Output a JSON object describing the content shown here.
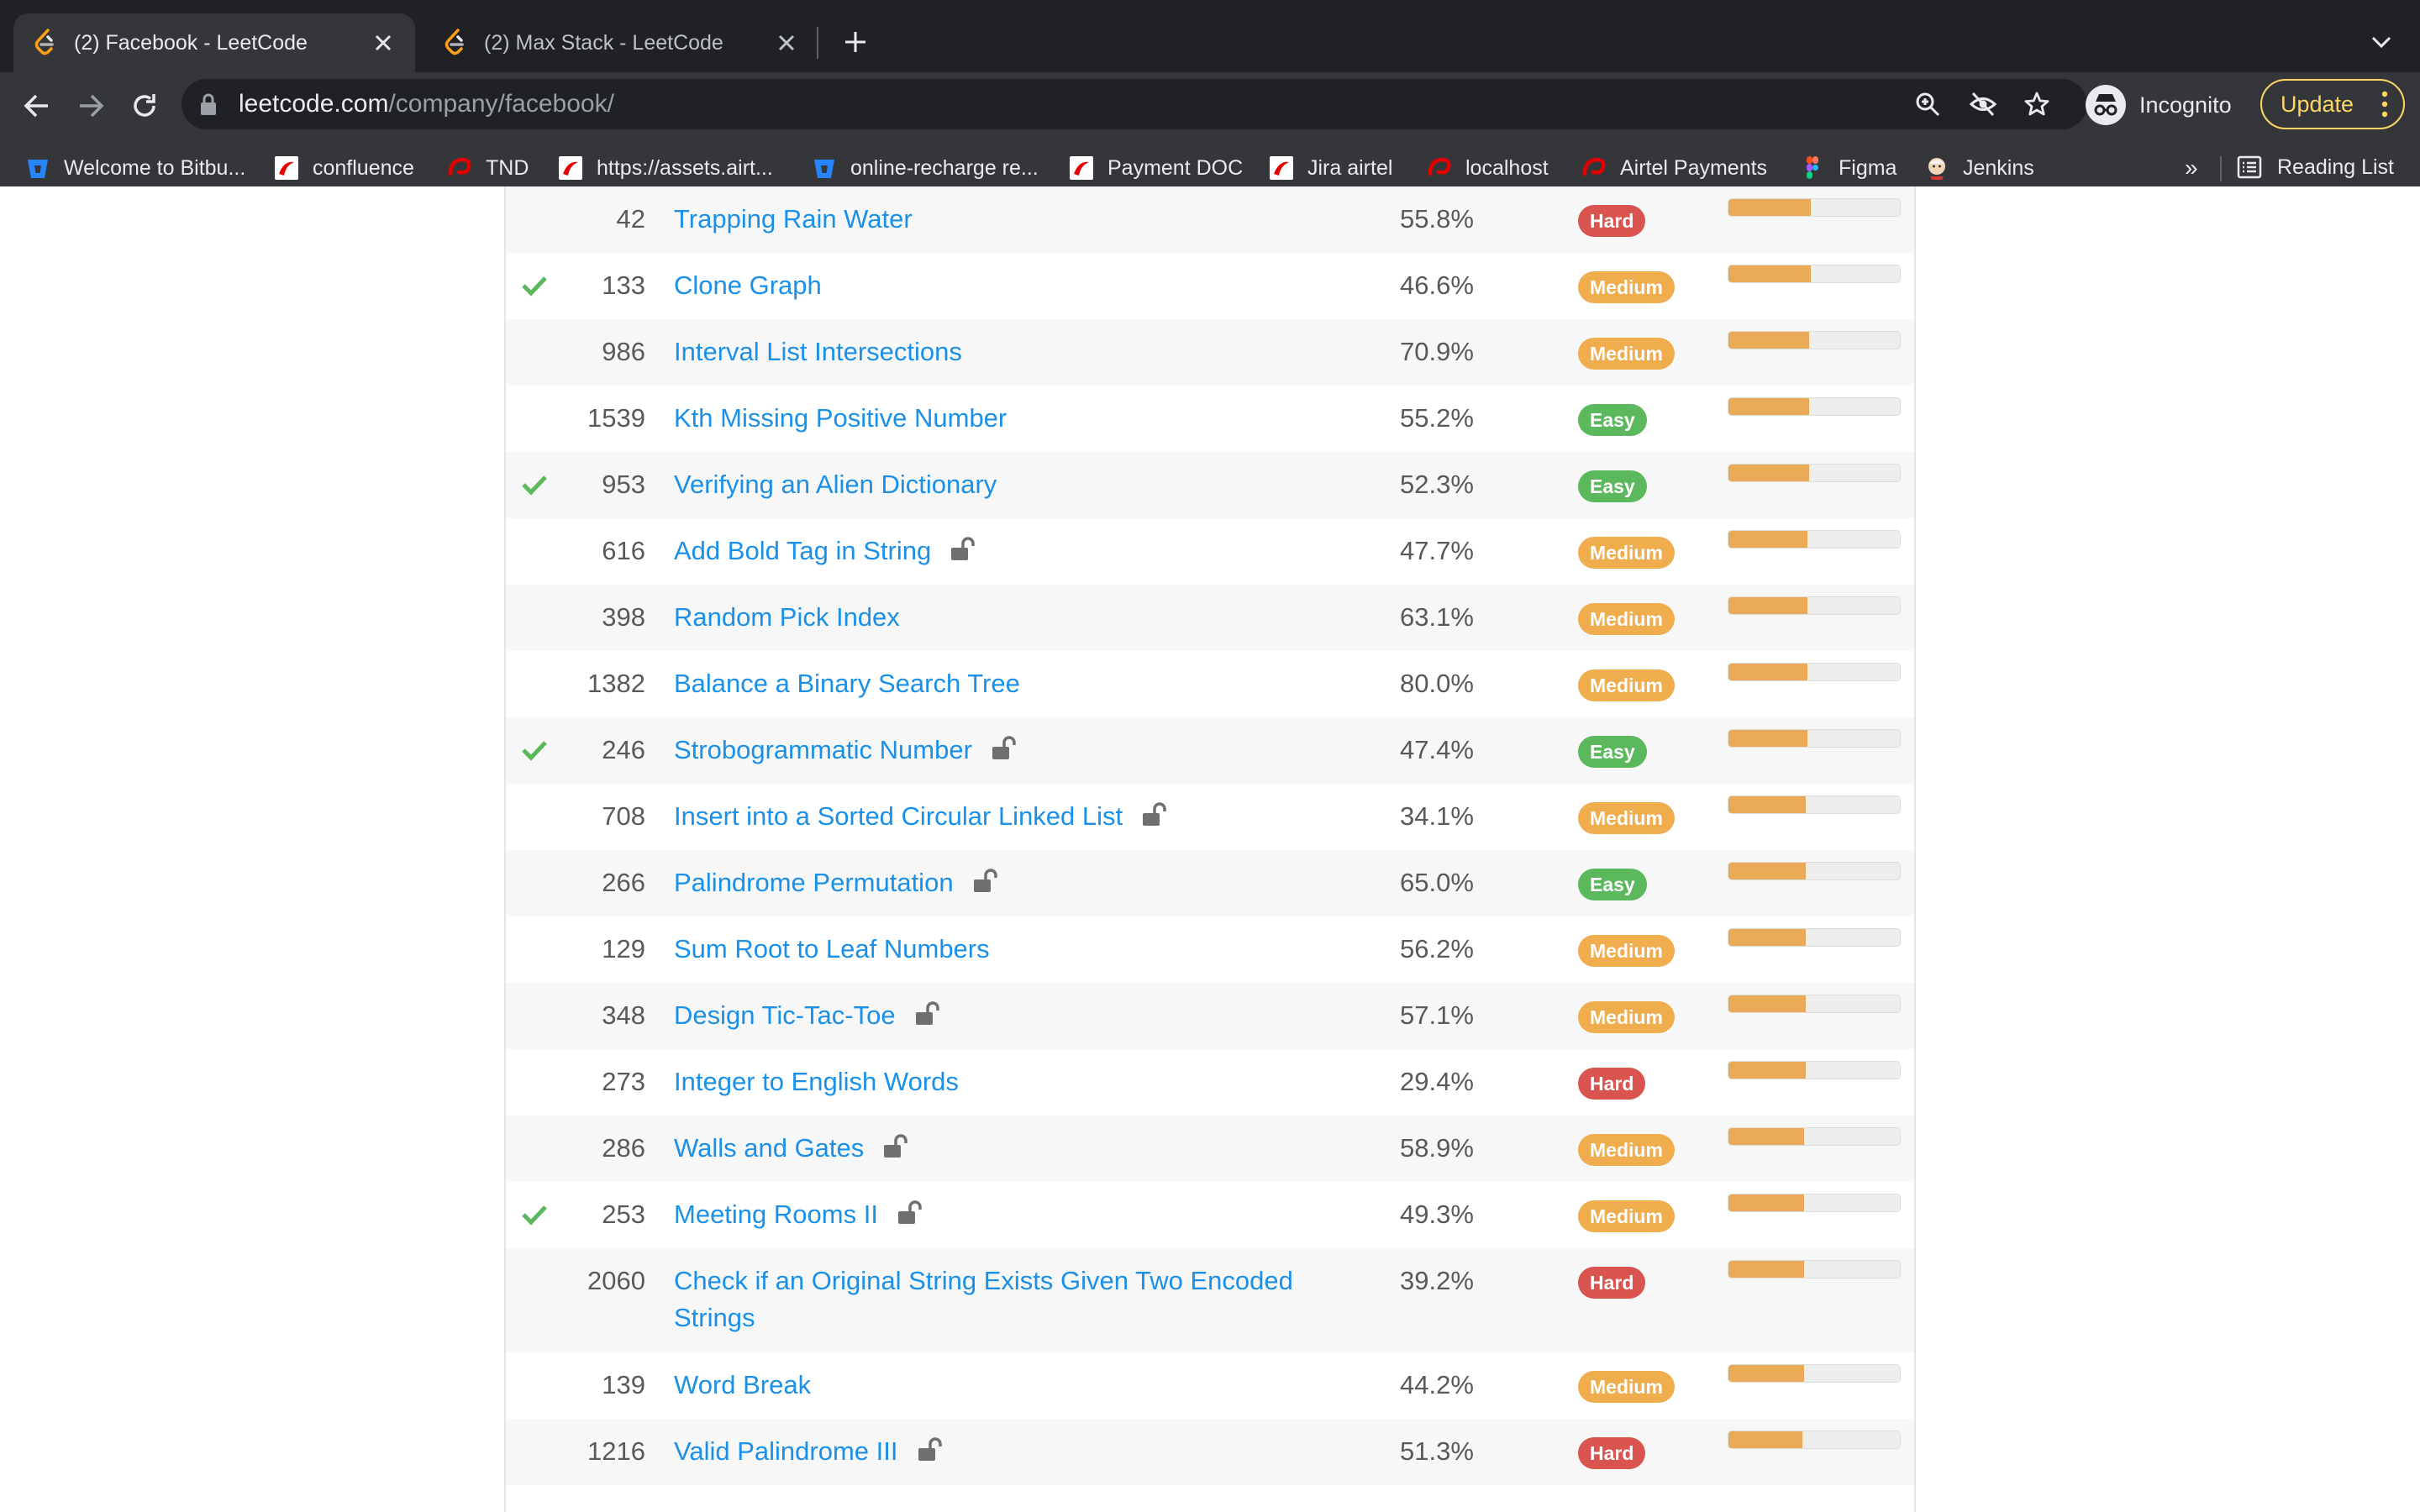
{
  "browser": {
    "tabs": [
      {
        "title": "(2) Facebook - LeetCode",
        "active": true
      },
      {
        "title": "(2) Max Stack - LeetCode",
        "active": false
      }
    ],
    "url": {
      "domain": "leetcode.com",
      "path": "/company/facebook/"
    },
    "incognito_label": "Incognito",
    "update_label": "Update",
    "bookmarks": [
      {
        "label": "Welcome to Bitbu...",
        "icon": "bitbucket-icon"
      },
      {
        "label": "confluence",
        "icon": "airtel-icon"
      },
      {
        "label": "TND",
        "icon": "airtel-swirl-icon"
      },
      {
        "label": "https://assets.airt...",
        "icon": "airtel-icon"
      },
      {
        "label": "online-recharge re...",
        "icon": "bitbucket-icon"
      },
      {
        "label": "Payment DOC",
        "icon": "airtel-icon"
      },
      {
        "label": "Jira airtel",
        "icon": "airtel-icon"
      },
      {
        "label": "localhost",
        "icon": "airtel-swirl-icon"
      },
      {
        "label": "Airtel Payments",
        "icon": "airtel-swirl-icon"
      },
      {
        "label": "Figma",
        "icon": "figma-icon"
      },
      {
        "label": "Jenkins",
        "icon": "jenkins-icon"
      }
    ],
    "bookmarks_overflow": "»",
    "reading_list_label": "Reading List"
  },
  "colors": {
    "easy": "#5cb85c",
    "medium": "#f0ad4e",
    "hard": "#d9534f",
    "link": "#1a90e8",
    "check": "#5cb85c",
    "frequency": "#e9aa55"
  },
  "problems": [
    {
      "id": "42",
      "title": "Trapping Rain Water",
      "acceptance": "55.8%",
      "difficulty": "Hard",
      "solved": false,
      "locked": false,
      "frequency": 0.48
    },
    {
      "id": "133",
      "title": "Clone Graph",
      "acceptance": "46.6%",
      "difficulty": "Medium",
      "solved": true,
      "locked": false,
      "frequency": 0.48
    },
    {
      "id": "986",
      "title": "Interval List Intersections",
      "acceptance": "70.9%",
      "difficulty": "Medium",
      "solved": false,
      "locked": false,
      "frequency": 0.47
    },
    {
      "id": "1539",
      "title": "Kth Missing Positive Number",
      "acceptance": "55.2%",
      "difficulty": "Easy",
      "solved": false,
      "locked": false,
      "frequency": 0.47
    },
    {
      "id": "953",
      "title": "Verifying an Alien Dictionary",
      "acceptance": "52.3%",
      "difficulty": "Easy",
      "solved": true,
      "locked": false,
      "frequency": 0.47
    },
    {
      "id": "616",
      "title": "Add Bold Tag in String",
      "acceptance": "47.7%",
      "difficulty": "Medium",
      "solved": false,
      "locked": true,
      "frequency": 0.46
    },
    {
      "id": "398",
      "title": "Random Pick Index",
      "acceptance": "63.1%",
      "difficulty": "Medium",
      "solved": false,
      "locked": false,
      "frequency": 0.46
    },
    {
      "id": "1382",
      "title": "Balance a Binary Search Tree",
      "acceptance": "80.0%",
      "difficulty": "Medium",
      "solved": false,
      "locked": false,
      "frequency": 0.46
    },
    {
      "id": "246",
      "title": "Strobogrammatic Number",
      "acceptance": "47.4%",
      "difficulty": "Easy",
      "solved": true,
      "locked": true,
      "frequency": 0.46
    },
    {
      "id": "708",
      "title": "Insert into a Sorted Circular Linked List",
      "acceptance": "34.1%",
      "difficulty": "Medium",
      "solved": false,
      "locked": true,
      "frequency": 0.45
    },
    {
      "id": "266",
      "title": "Palindrome Permutation",
      "acceptance": "65.0%",
      "difficulty": "Easy",
      "solved": false,
      "locked": true,
      "frequency": 0.45
    },
    {
      "id": "129",
      "title": "Sum Root to Leaf Numbers",
      "acceptance": "56.2%",
      "difficulty": "Medium",
      "solved": false,
      "locked": false,
      "frequency": 0.45
    },
    {
      "id": "348",
      "title": "Design Tic-Tac-Toe",
      "acceptance": "57.1%",
      "difficulty": "Medium",
      "solved": false,
      "locked": true,
      "frequency": 0.45
    },
    {
      "id": "273",
      "title": "Integer to English Words",
      "acceptance": "29.4%",
      "difficulty": "Hard",
      "solved": false,
      "locked": false,
      "frequency": 0.45
    },
    {
      "id": "286",
      "title": "Walls and Gates",
      "acceptance": "58.9%",
      "difficulty": "Medium",
      "solved": false,
      "locked": true,
      "frequency": 0.44
    },
    {
      "id": "253",
      "title": "Meeting Rooms II",
      "acceptance": "49.3%",
      "difficulty": "Medium",
      "solved": true,
      "locked": true,
      "frequency": 0.44
    },
    {
      "id": "2060",
      "title": "Check if an Original String Exists Given Two Encoded Strings",
      "acceptance": "39.2%",
      "difficulty": "Hard",
      "solved": false,
      "locked": false,
      "frequency": 0.44
    },
    {
      "id": "139",
      "title": "Word Break",
      "acceptance": "44.2%",
      "difficulty": "Medium",
      "solved": false,
      "locked": false,
      "frequency": 0.44
    },
    {
      "id": "1216",
      "title": "Valid Palindrome III",
      "acceptance": "51.3%",
      "difficulty": "Hard",
      "solved": false,
      "locked": true,
      "frequency": 0.43
    }
  ]
}
